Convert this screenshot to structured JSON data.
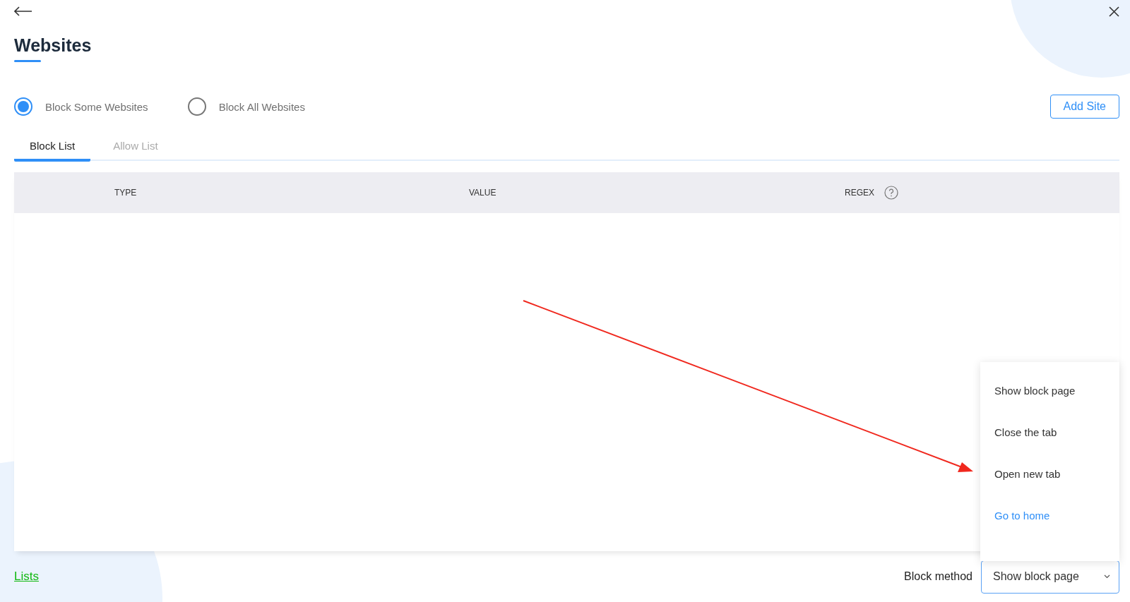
{
  "title": "Websites",
  "modes": [
    {
      "label": "Block Some Websites",
      "selected": true
    },
    {
      "label": "Block All Websites",
      "selected": false
    }
  ],
  "add_button": "Add Site",
  "tabs": [
    {
      "label": "Block List",
      "selected": true
    },
    {
      "label": "Allow List",
      "selected": false
    }
  ],
  "table": {
    "columns": [
      "TYPE",
      "VALUE",
      "REGEX"
    ]
  },
  "footer_link": "Lists",
  "block_method": {
    "label": "Block method",
    "value": "Show block page",
    "expanded": true,
    "options": [
      {
        "label": "Show block page",
        "highlighted": false
      },
      {
        "label": "Close the tab",
        "highlighted": false
      },
      {
        "label": "Open new tab",
        "highlighted": false
      },
      {
        "label": "Go to home",
        "highlighted": true
      }
    ]
  }
}
